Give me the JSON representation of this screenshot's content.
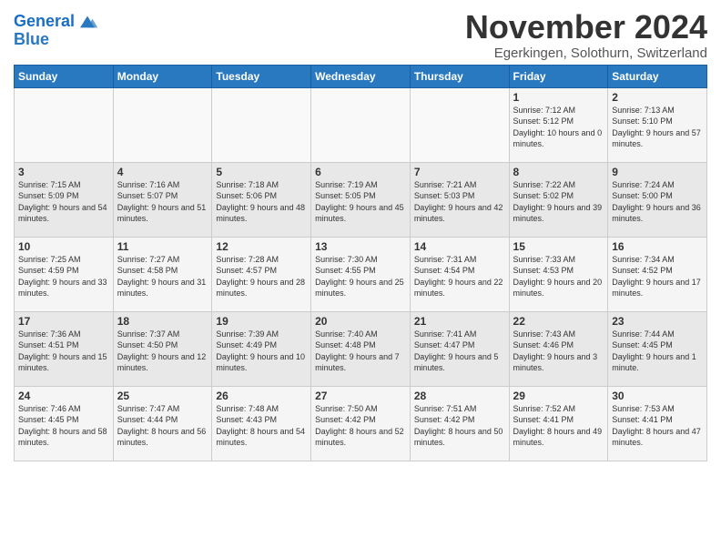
{
  "header": {
    "logo_line1": "General",
    "logo_line2": "Blue",
    "month_title": "November 2024",
    "location": "Egerkingen, Solothurn, Switzerland"
  },
  "days_of_week": [
    "Sunday",
    "Monday",
    "Tuesday",
    "Wednesday",
    "Thursday",
    "Friday",
    "Saturday"
  ],
  "weeks": [
    [
      {
        "day": "",
        "info": ""
      },
      {
        "day": "",
        "info": ""
      },
      {
        "day": "",
        "info": ""
      },
      {
        "day": "",
        "info": ""
      },
      {
        "day": "",
        "info": ""
      },
      {
        "day": "1",
        "info": "Sunrise: 7:12 AM\nSunset: 5:12 PM\nDaylight: 10 hours and 0 minutes."
      },
      {
        "day": "2",
        "info": "Sunrise: 7:13 AM\nSunset: 5:10 PM\nDaylight: 9 hours and 57 minutes."
      }
    ],
    [
      {
        "day": "3",
        "info": "Sunrise: 7:15 AM\nSunset: 5:09 PM\nDaylight: 9 hours and 54 minutes."
      },
      {
        "day": "4",
        "info": "Sunrise: 7:16 AM\nSunset: 5:07 PM\nDaylight: 9 hours and 51 minutes."
      },
      {
        "day": "5",
        "info": "Sunrise: 7:18 AM\nSunset: 5:06 PM\nDaylight: 9 hours and 48 minutes."
      },
      {
        "day": "6",
        "info": "Sunrise: 7:19 AM\nSunset: 5:05 PM\nDaylight: 9 hours and 45 minutes."
      },
      {
        "day": "7",
        "info": "Sunrise: 7:21 AM\nSunset: 5:03 PM\nDaylight: 9 hours and 42 minutes."
      },
      {
        "day": "8",
        "info": "Sunrise: 7:22 AM\nSunset: 5:02 PM\nDaylight: 9 hours and 39 minutes."
      },
      {
        "day": "9",
        "info": "Sunrise: 7:24 AM\nSunset: 5:00 PM\nDaylight: 9 hours and 36 minutes."
      }
    ],
    [
      {
        "day": "10",
        "info": "Sunrise: 7:25 AM\nSunset: 4:59 PM\nDaylight: 9 hours and 33 minutes."
      },
      {
        "day": "11",
        "info": "Sunrise: 7:27 AM\nSunset: 4:58 PM\nDaylight: 9 hours and 31 minutes."
      },
      {
        "day": "12",
        "info": "Sunrise: 7:28 AM\nSunset: 4:57 PM\nDaylight: 9 hours and 28 minutes."
      },
      {
        "day": "13",
        "info": "Sunrise: 7:30 AM\nSunset: 4:55 PM\nDaylight: 9 hours and 25 minutes."
      },
      {
        "day": "14",
        "info": "Sunrise: 7:31 AM\nSunset: 4:54 PM\nDaylight: 9 hours and 22 minutes."
      },
      {
        "day": "15",
        "info": "Sunrise: 7:33 AM\nSunset: 4:53 PM\nDaylight: 9 hours and 20 minutes."
      },
      {
        "day": "16",
        "info": "Sunrise: 7:34 AM\nSunset: 4:52 PM\nDaylight: 9 hours and 17 minutes."
      }
    ],
    [
      {
        "day": "17",
        "info": "Sunrise: 7:36 AM\nSunset: 4:51 PM\nDaylight: 9 hours and 15 minutes."
      },
      {
        "day": "18",
        "info": "Sunrise: 7:37 AM\nSunset: 4:50 PM\nDaylight: 9 hours and 12 minutes."
      },
      {
        "day": "19",
        "info": "Sunrise: 7:39 AM\nSunset: 4:49 PM\nDaylight: 9 hours and 10 minutes."
      },
      {
        "day": "20",
        "info": "Sunrise: 7:40 AM\nSunset: 4:48 PM\nDaylight: 9 hours and 7 minutes."
      },
      {
        "day": "21",
        "info": "Sunrise: 7:41 AM\nSunset: 4:47 PM\nDaylight: 9 hours and 5 minutes."
      },
      {
        "day": "22",
        "info": "Sunrise: 7:43 AM\nSunset: 4:46 PM\nDaylight: 9 hours and 3 minutes."
      },
      {
        "day": "23",
        "info": "Sunrise: 7:44 AM\nSunset: 4:45 PM\nDaylight: 9 hours and 1 minute."
      }
    ],
    [
      {
        "day": "24",
        "info": "Sunrise: 7:46 AM\nSunset: 4:45 PM\nDaylight: 8 hours and 58 minutes."
      },
      {
        "day": "25",
        "info": "Sunrise: 7:47 AM\nSunset: 4:44 PM\nDaylight: 8 hours and 56 minutes."
      },
      {
        "day": "26",
        "info": "Sunrise: 7:48 AM\nSunset: 4:43 PM\nDaylight: 8 hours and 54 minutes."
      },
      {
        "day": "27",
        "info": "Sunrise: 7:50 AM\nSunset: 4:42 PM\nDaylight: 8 hours and 52 minutes."
      },
      {
        "day": "28",
        "info": "Sunrise: 7:51 AM\nSunset: 4:42 PM\nDaylight: 8 hours and 50 minutes."
      },
      {
        "day": "29",
        "info": "Sunrise: 7:52 AM\nSunset: 4:41 PM\nDaylight: 8 hours and 49 minutes."
      },
      {
        "day": "30",
        "info": "Sunrise: 7:53 AM\nSunset: 4:41 PM\nDaylight: 8 hours and 47 minutes."
      }
    ]
  ]
}
